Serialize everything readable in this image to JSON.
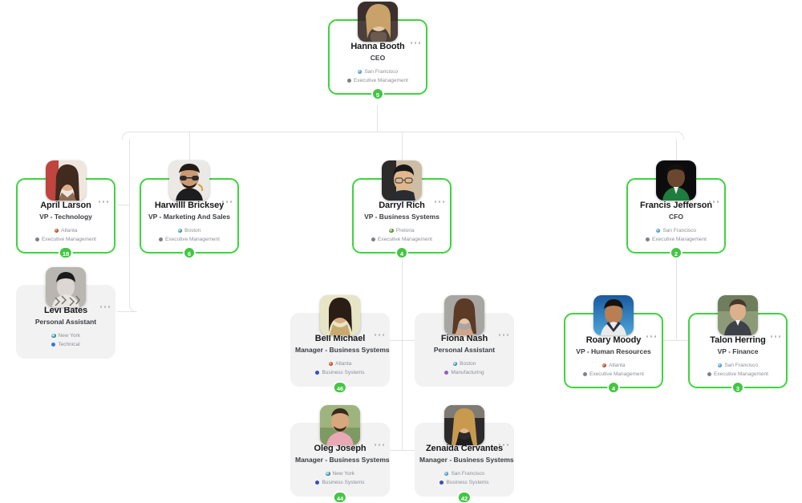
{
  "colors": {
    "accent_green": "#3ed43e",
    "badge_green": "#43c643",
    "card_plain_bg": "#f2f2f3",
    "connector": "#e2e3e5",
    "dept_executive": "#7d8086",
    "dept_technical": "#2f78e8",
    "dept_business_systems": "#3b4db5",
    "dept_manufacturing": "#9b59c6"
  },
  "nodes": {
    "hanna_booth": {
      "name": "Hanna Booth",
      "title": "CEO",
      "location": "San Francisco",
      "department": "Executive Management",
      "badge": "5",
      "menu": "more-options"
    },
    "april_larson": {
      "name": "April Larson",
      "title": "VP - Technology",
      "location": "Atlanta",
      "department": "Executive Management",
      "badge": "18",
      "menu": "more-options"
    },
    "harwilll_bricksey": {
      "name": "Harwilll Bricksey",
      "title": "VP - Marketing And Sales",
      "location": "Boston",
      "department": "Executive Management",
      "badge": "6",
      "menu": "more-options"
    },
    "darryl_rich": {
      "name": "Darryl Rich",
      "title": "VP - Business Systems",
      "location": "Pretoria",
      "department": "Executive Management",
      "badge": "4",
      "menu": "more-options"
    },
    "francis_jefferson": {
      "name": "Francis Jefferson",
      "title": "CFO",
      "location": "San Francisco",
      "department": "Executive Management",
      "badge": "2",
      "menu": "more-options"
    },
    "levi_bates": {
      "name": "Levi Bates",
      "title": "Personal Assistant",
      "location": "New York",
      "department": "Technical",
      "badge": "",
      "menu": "more-options"
    },
    "bell_michael": {
      "name": "Bell Michael",
      "title": "Manager - Business Systems",
      "location": "Atlanta",
      "department": "Business Systems",
      "badge": "46",
      "menu": "more-options"
    },
    "fiona_nash": {
      "name": "Fiona Nash",
      "title": "Personal Assistant",
      "location": "Boston",
      "department": "Manufacturing",
      "badge": "",
      "menu": "more-options"
    },
    "roary_moody": {
      "name": "Roary Moody",
      "title": "VP - Human Resources",
      "location": "Atlanta",
      "department": "Executive Management",
      "badge": "4",
      "menu": "more-options"
    },
    "talon_herring": {
      "name": "Talon Herring",
      "title": "VP - Finance",
      "location": "San Francisco",
      "department": "Executive Management",
      "badge": "3",
      "menu": "more-options"
    },
    "oleg_joseph": {
      "name": "Oleg Joseph",
      "title": "Manager - Business Systems",
      "location": "New York",
      "department": "Business Systems",
      "badge": "44",
      "menu": "more-options"
    },
    "zenaida_cervantes": {
      "name": "Zenaida Cervantes",
      "title": "Manager - Business Systems",
      "location": "San Francisco",
      "department": "Business Systems",
      "badge": "42",
      "menu": "more-options"
    }
  }
}
